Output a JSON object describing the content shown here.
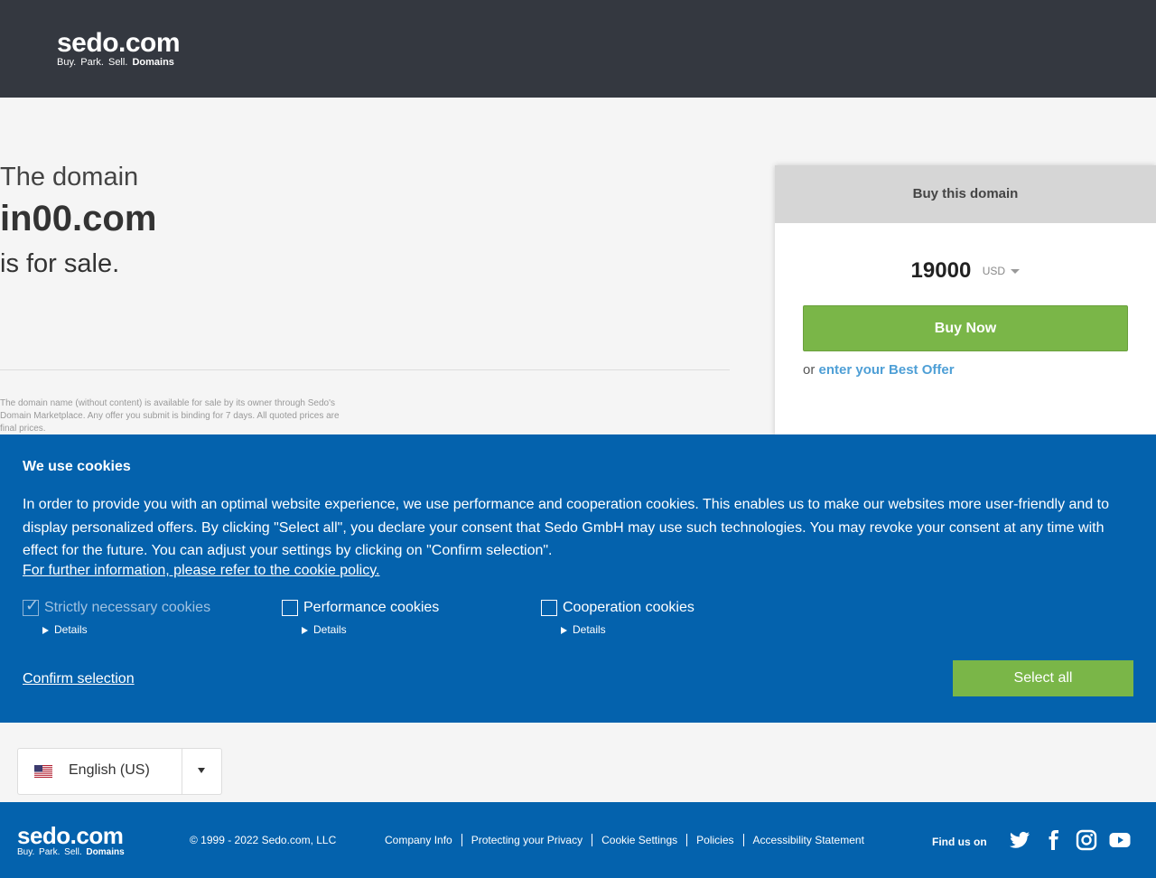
{
  "header": {
    "logo_main": "sedo.com",
    "logo_tag_plain": "Buy. Park. Sell.",
    "logo_tag_bold": "Domains"
  },
  "intro": {
    "line1": "The domain",
    "domain": "in00.com",
    "line3": "is for sale."
  },
  "disclaimer": "The domain name (without content) is available for sale by its owner through Sedo's Domain Marketplace. Any offer you submit is binding for 7 days. All quoted prices are final prices.",
  "buybox": {
    "title": "Buy this domain",
    "price": "19000",
    "currency": "USD",
    "buy_label": "Buy Now",
    "offer_prefix": "or",
    "offer_link": "enter your Best Offer"
  },
  "cookie": {
    "title": "We use cookies",
    "text": "In order to provide you with an optimal website experience, we use performance and cooperation cookies. This enables us to make our websites more user-friendly and to display personalized offers. By clicking \"Select all\", you declare your consent that Sedo GmbH may use such technologies. You may revoke your consent at any time with effect for the future. You can adjust your settings by clicking on \"Confirm selection\".",
    "more_link": "For further information, please refer to the cookie policy.",
    "options": [
      {
        "label": "Strictly necessary cookies",
        "details": "Details",
        "checked": true
      },
      {
        "label": "Performance cookies",
        "details": "Details",
        "checked": false
      },
      {
        "label": "Cooperation cookies",
        "details": "Details",
        "checked": false
      }
    ],
    "confirm_label": "Confirm selection",
    "select_all_label": "Select all"
  },
  "language": {
    "current": "English (US)"
  },
  "footer": {
    "logo_main": "sedo.com",
    "logo_tag_plain": "Buy. Park. Sell.",
    "logo_tag_bold": "Domains",
    "copyright": "© 1999 - 2022 Sedo.com, LLC",
    "links": [
      "Company Info",
      "Protecting your Privacy",
      "Cookie Settings",
      "Policies",
      "Accessibility Statement"
    ],
    "find_us": "Find us on",
    "social_icons": [
      "twitter-icon",
      "facebook-icon",
      "instagram-icon",
      "youtube-icon"
    ]
  },
  "colors": {
    "header_bg": "#343840",
    "banner_bg": "#0462ad",
    "green": "#7ab648",
    "link_blue": "#4e9fd6"
  }
}
